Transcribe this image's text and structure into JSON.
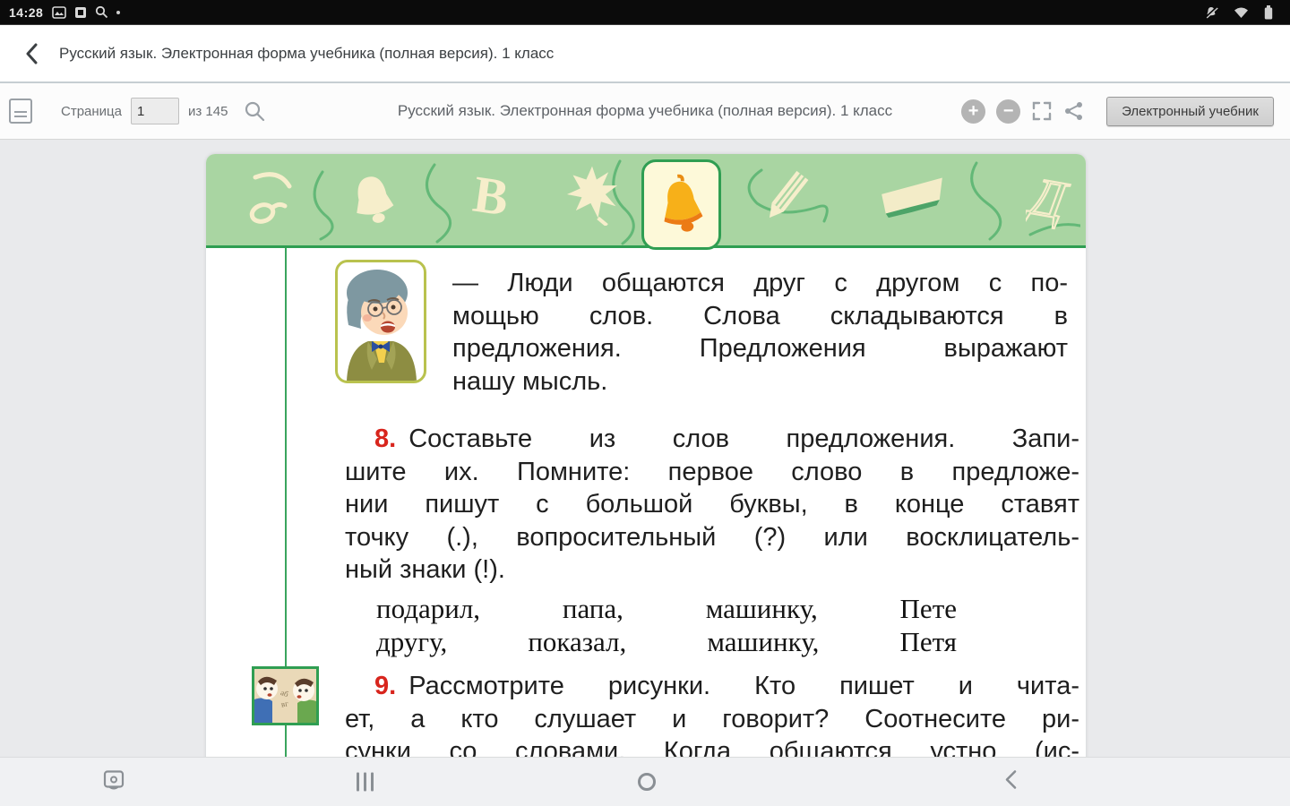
{
  "colors": {
    "accent_green": "#2f9e52",
    "band_green": "#a9d5a2",
    "icon_cream": "#f6eecb",
    "tab_cream": "#fdf9d9",
    "exercise_red": "#d8251d",
    "content_bg": "#e9eaec",
    "nav_bg": "#f0f1f3"
  },
  "status_bar": {
    "time": "14:28"
  },
  "app_header": {
    "title": "Русский язык. Электронная форма учебника (полная версия). 1 класс"
  },
  "toolbar": {
    "page_label": "Страница",
    "page_value": "1",
    "page_total_label": "из 145",
    "title": "Русский язык. Электронная форма учебника (полная версия). 1 класс",
    "zoom_in_glyph": "+",
    "zoom_out_glyph": "−",
    "ebook_button_label": "Электронный учебник"
  },
  "book_page": {
    "band_letter_v": "В",
    "band_letter_d": "Д",
    "intro_lines": [
      "— Люди общаются друг с другом с по-",
      "мощью слов. Слова складываются в",
      "предложения. Предложения выражают",
      "нашу мысль."
    ],
    "exercise8": {
      "number": "8.",
      "line1": "Составьте из слов предложения. Запи-",
      "lines": [
        "шите их. Помните: первое слово в предложе-",
        "нии пишут с большой буквы, в конце ставят",
        "точку (.), вопросительный (?) или восклицатель-",
        "ный знаки (!)."
      ]
    },
    "word_list_lines": [
      "подарил, папа, машинку, Пете",
      "другу, показал, машинку, Петя"
    ],
    "exercise9": {
      "number": "9.",
      "line1": "Рассмотрите рисунки. Кто пишет и чита-",
      "lines": [
        "ет, а кто слушает и говорит? Соотнесите ри-",
        "сунки со словами. Когда общаются устно (ис-"
      ]
    }
  }
}
